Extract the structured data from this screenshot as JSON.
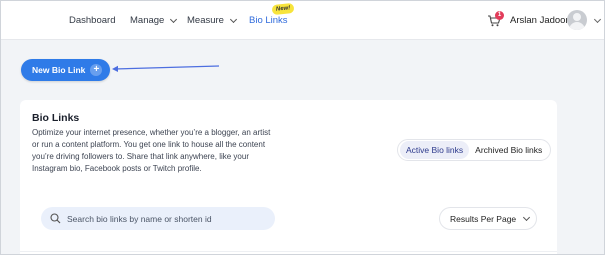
{
  "nav": {
    "items": [
      {
        "label": "Dashboard",
        "has_dropdown": false
      },
      {
        "label": "Manage",
        "has_dropdown": true
      },
      {
        "label": "Measure",
        "has_dropdown": true
      },
      {
        "label": "Bio Links",
        "has_dropdown": false,
        "active": true
      }
    ],
    "new_badge": "New!",
    "cart_count": "1",
    "user_name": "Arslan Jadoon",
    "accent_color": "#2f6bdc"
  },
  "new_button": {
    "label": "New Bio Link",
    "icon": "plus-icon",
    "color": "#2f7be8"
  },
  "card": {
    "title": "Bio Links",
    "description": "Optimize your internet presence, whether you’re a blogger, an artist or run a content platform. You get one link to house all the content you’re driving followers to. Share that link anywhere, like your Instagram bio, Facebook posts or Twitch profile.",
    "tabs": [
      {
        "label": "Active Bio links",
        "active": true
      },
      {
        "label": "Archived Bio links",
        "active": false
      }
    ],
    "search_placeholder": "Search bio links by name or shorten id",
    "results_per_page": "Results Per Page"
  }
}
